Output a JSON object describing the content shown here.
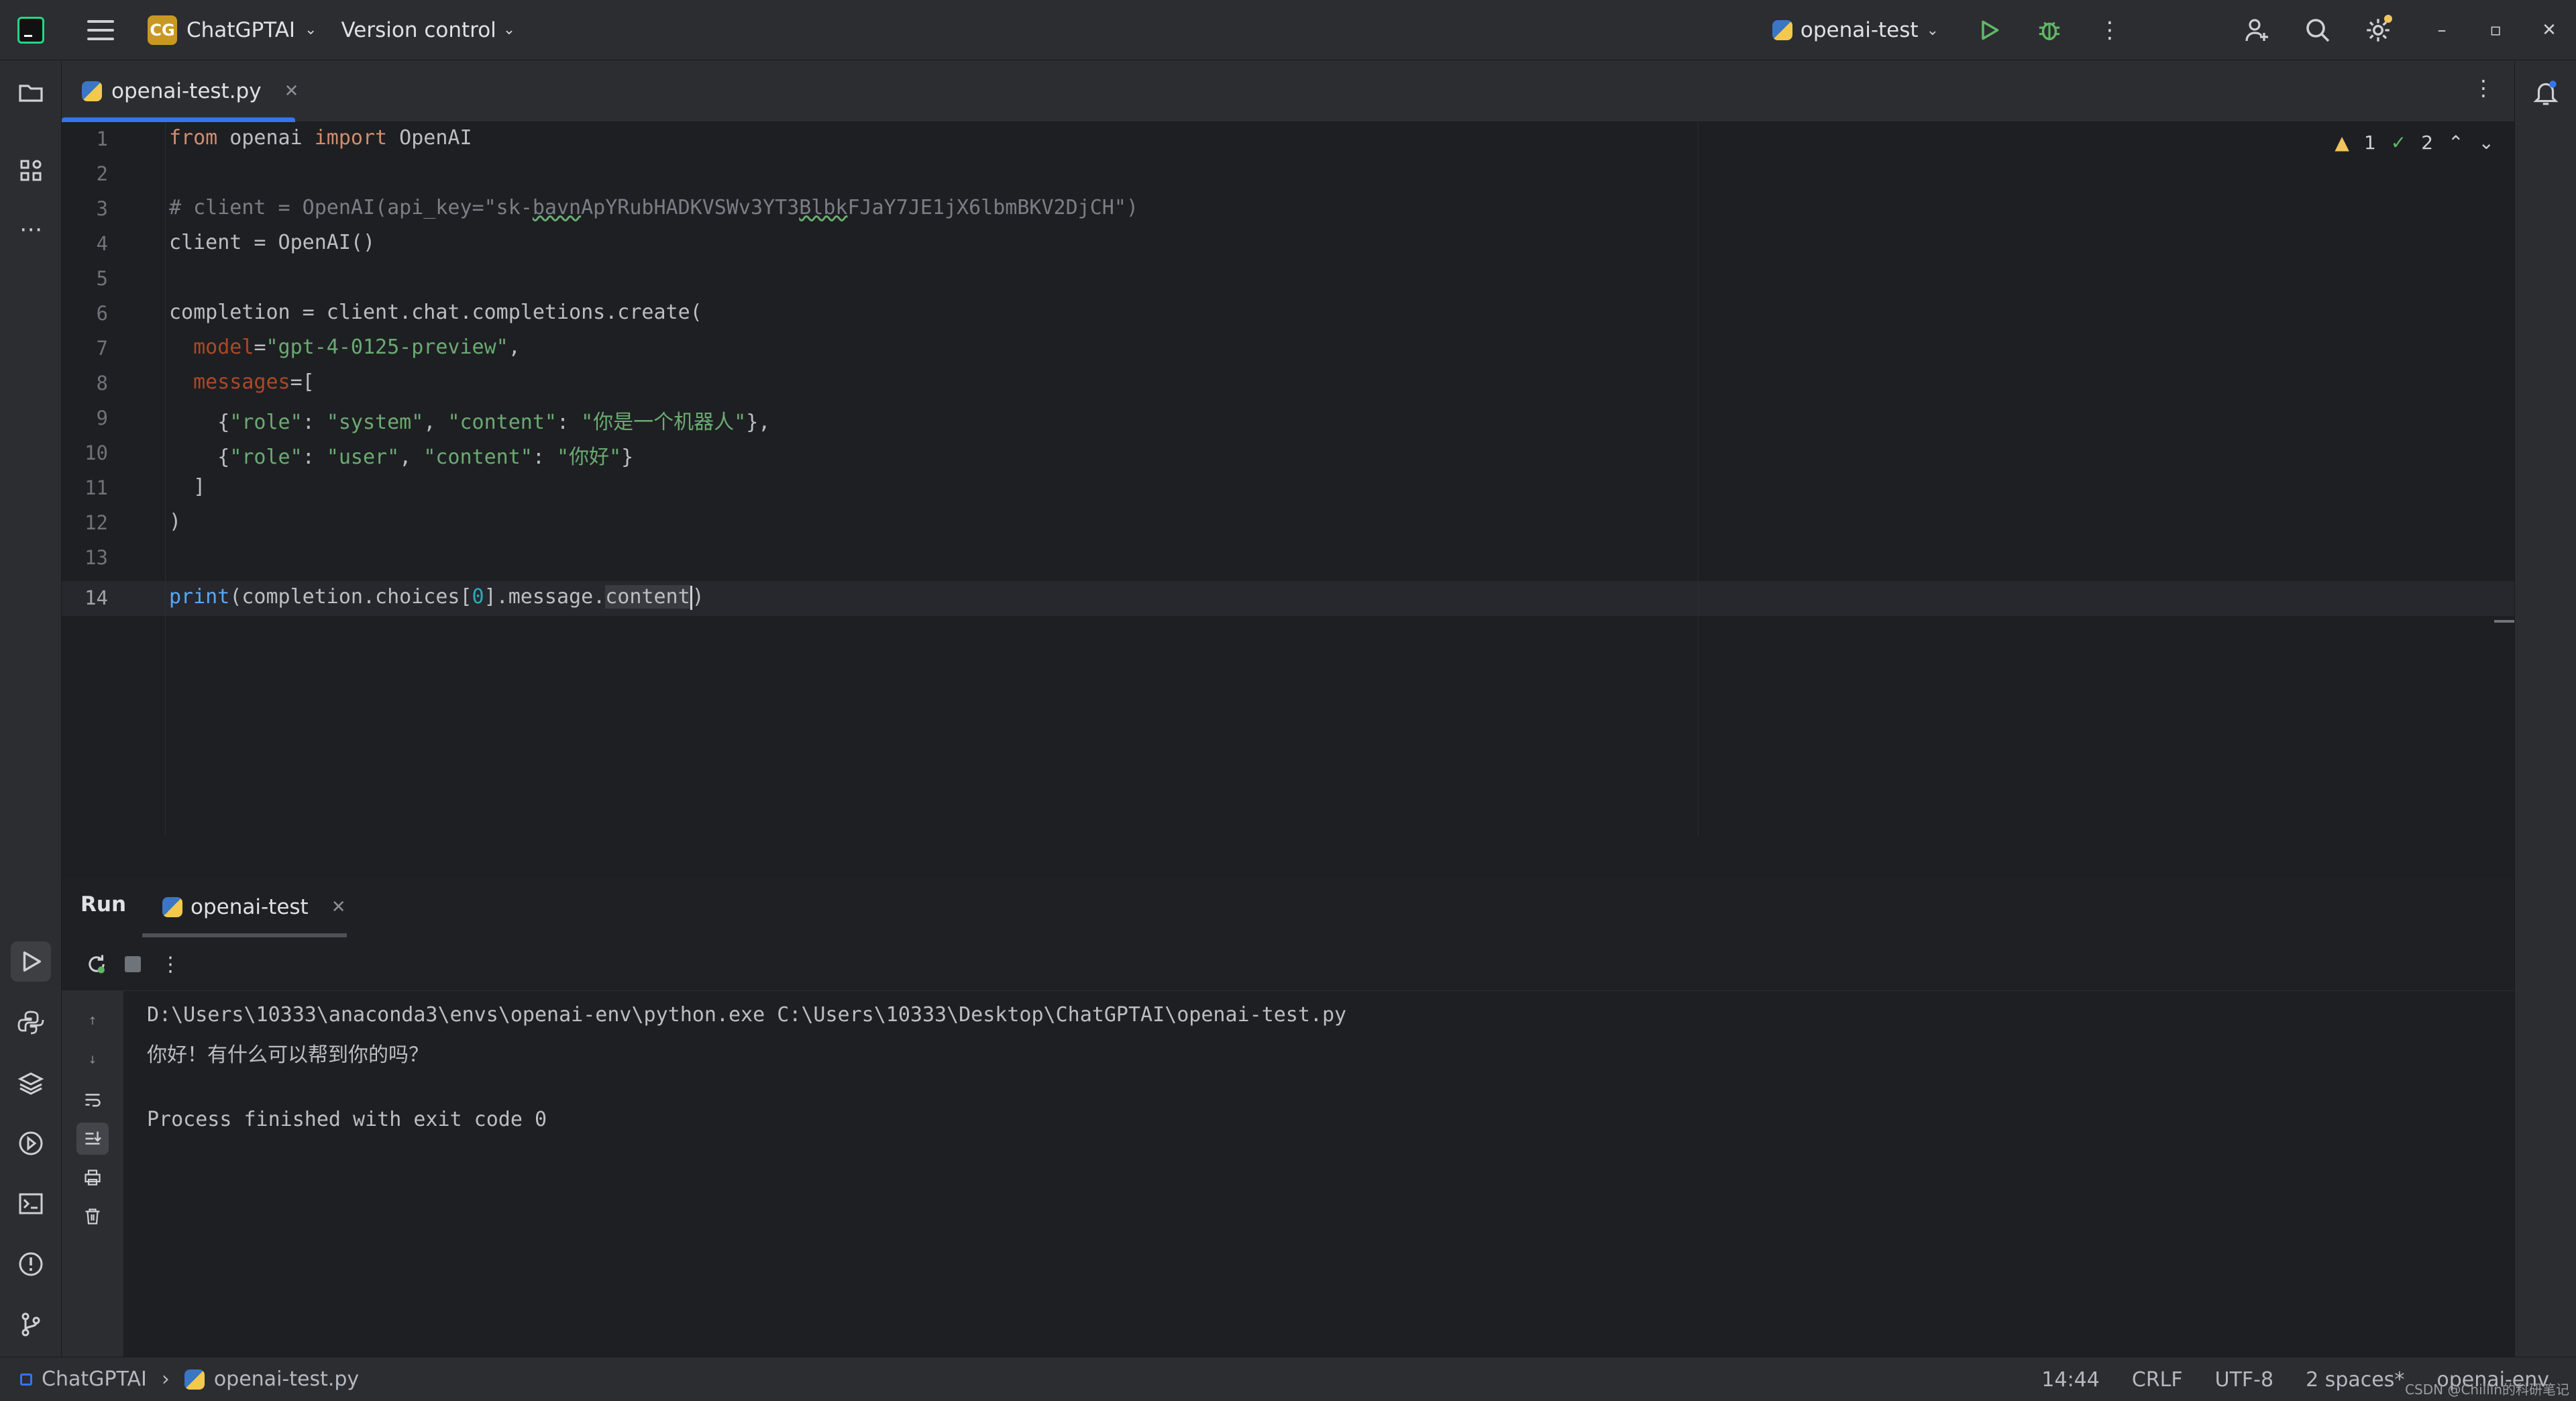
{
  "titlebar": {
    "project_badge": "CG",
    "project_name": "ChatGPTAI",
    "vcs_label": "Version control",
    "run_config": "openai-test"
  },
  "editor_tab": {
    "file_name": "openai-test.py"
  },
  "inspections": {
    "warnings": "1",
    "weak_warnings": "2"
  },
  "code": {
    "line_numbers": [
      "1",
      "2",
      "3",
      "4",
      "5",
      "6",
      "7",
      "8",
      "9",
      "10",
      "11",
      "12",
      "13",
      "14"
    ],
    "l1_from": "from",
    "l1_mod": " openai ",
    "l1_import": "import",
    "l1_name": " OpenAI",
    "l3_comment_a": "# client = OpenAI(api_key=\"sk-",
    "l3_comment_b": "bavn",
    "l3_comment_c": "ApYRubHADKVSWv3YT3",
    "l3_comment_d": "Blbk",
    "l3_comment_e": "FJaY7JE1jX6lbmBKV2DjCH\")",
    "l4": "client = OpenAI()",
    "l6": "completion = client.chat.completions.create(",
    "l7_param": "model",
    "l7_eq": "=",
    "l7_str": "\"gpt-4-0125-preview\"",
    "l7_comma": ",",
    "l8_param": "messages",
    "l8_rest": "=[",
    "l9_open": "{",
    "l9_k1": "\"role\"",
    "l9_c1": ": ",
    "l9_v1": "\"system\"",
    "l9_c2": ", ",
    "l9_k2": "\"content\"",
    "l9_c3": ": ",
    "l9_v2": "\"你是一个机器人\"",
    "l9_close": "},",
    "l10_open": "{",
    "l10_k1": "\"role\"",
    "l10_c1": ": ",
    "l10_v1": "\"user\"",
    "l10_c2": ", ",
    "l10_k2": "\"content\"",
    "l10_c3": ": ",
    "l10_v2": "\"你好\"",
    "l10_close": "}",
    "l11": "]",
    "l12": ")",
    "l14_print": "print",
    "l14_a": "(completion.choices[",
    "l14_num": "0",
    "l14_b": "].message.",
    "l14_c": "content",
    "l14_d": ")"
  },
  "run_panel": {
    "title": "Run",
    "tab_label": "openai-test",
    "console": [
      "D:\\Users\\10333\\anaconda3\\envs\\openai-env\\python.exe C:\\Users\\10333\\Desktop\\ChatGPTAI\\openai-test.py",
      "你好！有什么可以帮到你的吗？",
      "Process finished with exit code 0"
    ]
  },
  "statusbar": {
    "project": "ChatGPTAI",
    "file": "openai-test.py",
    "position": "14:44",
    "line_sep": "CRLF",
    "encoding": "UTF-8",
    "indent": "2 spaces*",
    "interpreter": "openai-env",
    "watermark": "CSDN @Chillin的科研笔记"
  },
  "colors": {
    "accent": "#3574f0",
    "keyword": "#cf8e6d",
    "string": "#6aab73",
    "number": "#2aacb8",
    "run_green": "#5fb865"
  },
  "icons": [
    "project-logo",
    "hamburger-icon",
    "run-icon",
    "debug-icon",
    "more-icon",
    "add-user-icon",
    "search-icon",
    "settings-icon",
    "folder-icon",
    "structure-icon",
    "python-console-icon",
    "layers-icon",
    "services-icon",
    "terminal-icon",
    "problems-icon",
    "git-icon",
    "notifications-icon",
    "rerun-icon",
    "stop-icon",
    "up-arrow-icon",
    "down-arrow-icon",
    "soft-wrap-icon",
    "scroll-end-icon",
    "print-icon",
    "trash-icon"
  ]
}
